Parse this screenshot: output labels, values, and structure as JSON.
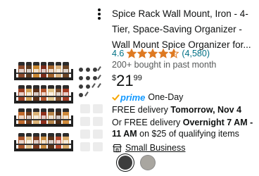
{
  "product": {
    "title": "Spice Rack Wall Mount, Iron - 4-Tier, Space-Saving Organizer - Wall Mount Spice Organizer for...",
    "rating": "4.6",
    "stars_filled_fraction": 0.92,
    "review_count": "(4,580)",
    "bought": "200+ bought in past month",
    "price": {
      "currency": "$",
      "whole": "21",
      "fraction": "99"
    },
    "prime": {
      "word": "prime",
      "label": "One-Day"
    },
    "delivery_free": {
      "prefix": "FREE delivery ",
      "date": "Tomorrow, Nov 4"
    },
    "delivery_fast": {
      "prefix": "Or FREE delivery ",
      "window": "Overnight 7 AM - 11 AM",
      "suffix": " on $25 of qualifying items"
    },
    "small_business": "Small Business",
    "swatches": [
      {
        "name": "black",
        "color": "#3d3d3d",
        "selected": true
      },
      {
        "name": "silver",
        "color": "#a9a6a0",
        "selected": false
      }
    ]
  },
  "colors": {
    "link": "#007185",
    "star": "#de7921",
    "prime": "#1399ff",
    "text": "#0f1111",
    "muted": "#565959"
  },
  "icons": {
    "menu": "more-vertical-icon",
    "prime_check": "prime-check-icon",
    "small_business": "small-business-icon",
    "star": "star-icon"
  }
}
